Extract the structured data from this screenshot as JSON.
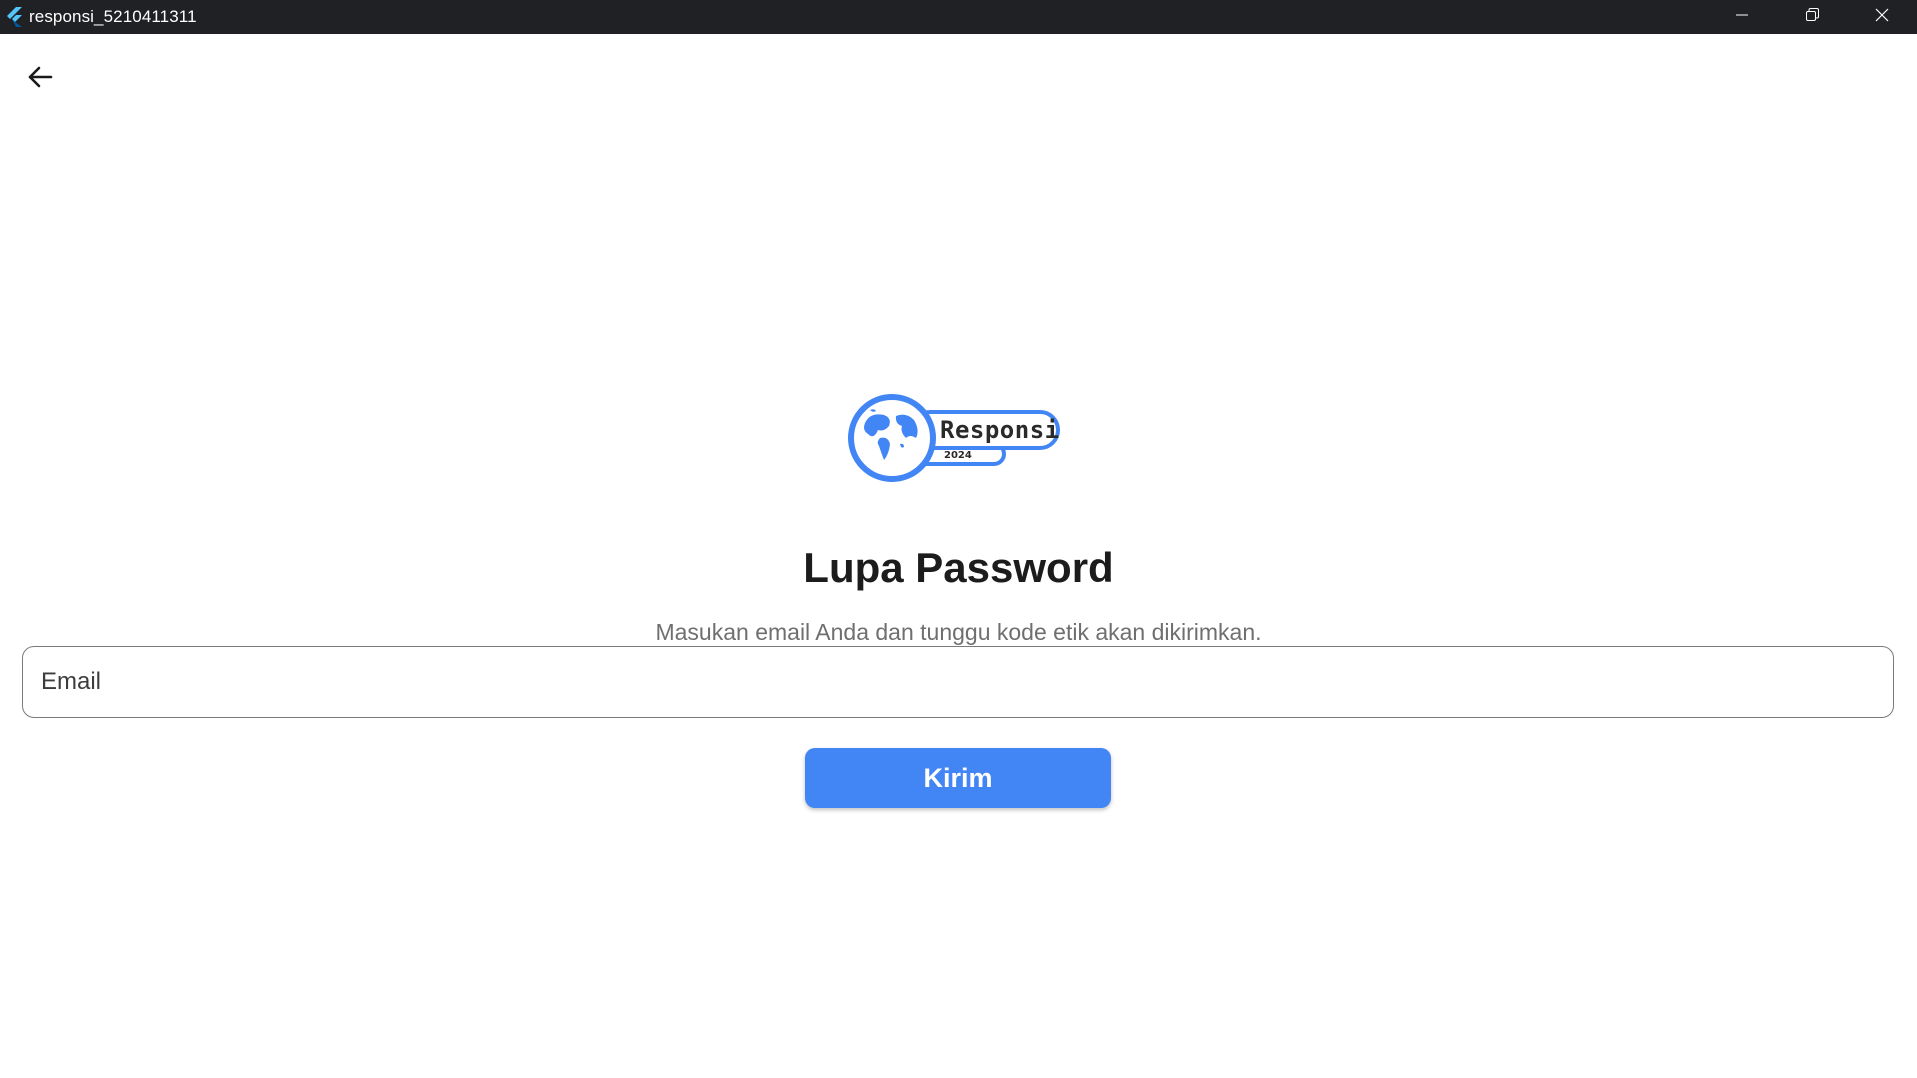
{
  "window": {
    "title": "responsi_5210411311",
    "icon": "flutter-icon",
    "controls": [
      "minimize-icon",
      "restore-icon",
      "close-icon"
    ]
  },
  "app_bar": {
    "back_icon": "arrow-left-icon"
  },
  "logo": {
    "brand_text": "Responsi",
    "year_text": "2024",
    "accent_color": "#4285f4"
  },
  "main": {
    "title": "Lupa Password",
    "subtitle": "Masukan email Anda dan tunggu kode etik akan dikirimkan.",
    "email_field": {
      "placeholder": "Email",
      "value": ""
    },
    "submit_label": "Kirim"
  },
  "colors": {
    "titlebar": "#202124",
    "primary": "#4285f4",
    "title_text": "#1c1c1c",
    "subtitle_text": "#6f6f6f"
  }
}
